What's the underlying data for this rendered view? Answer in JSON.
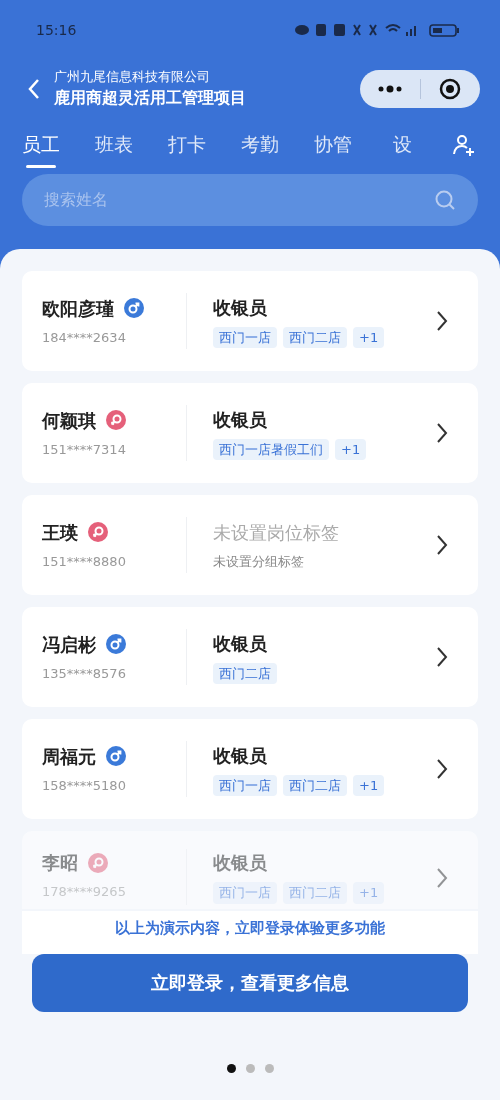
{
  "status_bar": {
    "time": "15:16"
  },
  "header": {
    "company": "广州九尾信息科技有限公司",
    "project": "鹿用商超灵活用工管理项目"
  },
  "tabs": [
    {
      "label": "员工",
      "selected": true
    },
    {
      "label": "班表",
      "selected": false
    },
    {
      "label": "打卡",
      "selected": false
    },
    {
      "label": "考勤",
      "selected": false
    },
    {
      "label": "协管",
      "selected": false
    },
    {
      "label": "设",
      "selected": false
    }
  ],
  "search": {
    "placeholder": "搜索姓名"
  },
  "employees": [
    {
      "name": "欧阳彦瑾",
      "male": true,
      "phone": "184****2634",
      "role": "收银员",
      "role_unset": false,
      "tags": [
        "西门一店",
        "西门二店",
        "+1"
      ],
      "faded": false
    },
    {
      "name": "何颖琪",
      "male": false,
      "phone": "151****7314",
      "role": "收银员",
      "role_unset": false,
      "tags": [
        "西门一店暑假工们",
        "+1"
      ],
      "faded": false
    },
    {
      "name": "王瑛",
      "male": false,
      "phone": "151****8880",
      "role": "未设置岗位标签",
      "role_unset": true,
      "group_note": "未设置分组标签",
      "faded": false
    },
    {
      "name": "冯启彬",
      "male": true,
      "phone": "135****8576",
      "role": "收银员",
      "role_unset": false,
      "tags": [
        "西门二店"
      ],
      "faded": false
    },
    {
      "name": "周福元",
      "male": true,
      "phone": "158****5180",
      "role": "收银员",
      "role_unset": false,
      "tags": [
        "西门一店",
        "西门二店",
        "+1"
      ],
      "faded": false
    },
    {
      "name": "李昭",
      "male": false,
      "phone": "178****9265",
      "role": "收银员",
      "role_unset": false,
      "tags": [
        "西门一店",
        "西门二店",
        "+1"
      ],
      "faded": true
    }
  ],
  "demo_notice": "以上为演示内容，立即登录体验更多功能",
  "login_button": "立即登录，查看更多信息",
  "pager": [
    {
      "selected": true
    },
    {
      "selected": false
    },
    {
      "selected": false
    }
  ]
}
